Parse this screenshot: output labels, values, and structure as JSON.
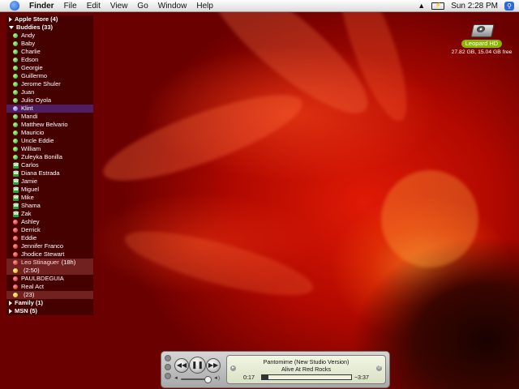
{
  "menubar": {
    "app_name": "Finder",
    "menus": [
      "File",
      "Edit",
      "View",
      "Go",
      "Window",
      "Help"
    ],
    "clock": "Sun 2:28 PM",
    "icons": [
      "apple-icon",
      "wifi-icon",
      "battery-icon",
      "spotlight-icon"
    ]
  },
  "buddy_list": {
    "groups": {
      "apple_store": "Apple Store (4)",
      "buddies": "Buddies (33)",
      "family": "Family (1)",
      "msn": "MSN (5)"
    },
    "buddies": [
      {
        "name": "Andy",
        "status": "green"
      },
      {
        "name": "Baby",
        "status": "green"
      },
      {
        "name": "Charlie",
        "status": "green"
      },
      {
        "name": "Edson",
        "status": "green"
      },
      {
        "name": "Georgie",
        "status": "green"
      },
      {
        "name": "Guillermo",
        "status": "green"
      },
      {
        "name": "Jerome Shuler",
        "status": "green"
      },
      {
        "name": "Juan",
        "status": "green"
      },
      {
        "name": "Julio Oyola",
        "status": "green"
      },
      {
        "name": "Klint",
        "status": "purple",
        "selected": true
      },
      {
        "name": "Mandi",
        "status": "green"
      },
      {
        "name": "Matthew Belvario",
        "status": "green"
      },
      {
        "name": "Mauricio",
        "status": "green"
      },
      {
        "name": "Uncle Eddie",
        "status": "green"
      },
      {
        "name": "William",
        "status": "green"
      },
      {
        "name": "Zuleyka Bonilla",
        "status": "green"
      },
      {
        "name": "Carlos",
        "status": "phone"
      },
      {
        "name": "Diana Estrada",
        "status": "phone"
      },
      {
        "name": "Jamie",
        "status": "phone"
      },
      {
        "name": "Miguel",
        "status": "phone"
      },
      {
        "name": "Mike",
        "status": "phone"
      },
      {
        "name": "Shama",
        "status": "phone"
      },
      {
        "name": "Zak",
        "status": "phone"
      },
      {
        "name": "Ashley",
        "status": "red"
      },
      {
        "name": "Derrick",
        "status": "red"
      },
      {
        "name": "Eddie",
        "status": "red"
      },
      {
        "name": "Jennifer Franco",
        "status": "red"
      },
      {
        "name": "Jhodice Stewart",
        "status": "red"
      },
      {
        "name": "Leo Stinaguer",
        "status": "red",
        "idle": "(18h)",
        "faded": true
      },
      {
        "name": "",
        "status": "yellow",
        "idle": "(2:50)",
        "faded": true
      },
      {
        "name": "PAULBDEGUIA",
        "status": "red"
      },
      {
        "name": "Real Act",
        "status": "red"
      },
      {
        "name": "",
        "status": "yellow",
        "idle": "(23)",
        "faded": true
      }
    ]
  },
  "desktop": {
    "drive_name": "Leopard HD",
    "drive_info": "27.82 GB, 15.04 GB free"
  },
  "itunes": {
    "track": "Pantomime (New Studio Version)",
    "artist_album": "Alive At Red Rocks",
    "elapsed": "0:17",
    "remaining": "−3:37",
    "progress_fraction": 0.07,
    "volume_fraction": 0.85,
    "controls": [
      "previous-icon",
      "pause-icon",
      "next-icon"
    ]
  },
  "colors": {
    "selected_row": "#46288a",
    "drive_label_bg": "#8ab800",
    "available": "#2ca11a",
    "away": "#c41a1a"
  }
}
